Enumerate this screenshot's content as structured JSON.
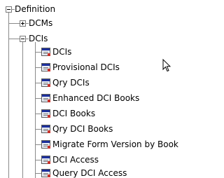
{
  "tree": {
    "root": {
      "label": "Definition",
      "expanded": true
    },
    "children": [
      {
        "label": "DCMs",
        "expanded": false
      },
      {
        "label": "DCIs",
        "expanded": true,
        "items": [
          {
            "label": "DCIs",
            "icon": "form-icon"
          },
          {
            "label": "Provisional DCIs",
            "icon": "form-icon"
          },
          {
            "label": "Qry DCIs",
            "icon": "form-icon"
          },
          {
            "label": "Enhanced DCI Books",
            "icon": "form-icon"
          },
          {
            "label": "DCI Books",
            "icon": "form-icon"
          },
          {
            "label": "Qry DCI Books",
            "icon": "form-icon"
          },
          {
            "label": "Migrate Form Version by Book",
            "icon": "form-icon"
          },
          {
            "label": "DCI Access",
            "icon": "form-icon"
          },
          {
            "label": "Query DCI Access",
            "icon": "form-icon"
          }
        ]
      }
    ]
  },
  "colors": {
    "icon_bar": "#1c2f9c",
    "tree_line": "#8a8a8a"
  }
}
